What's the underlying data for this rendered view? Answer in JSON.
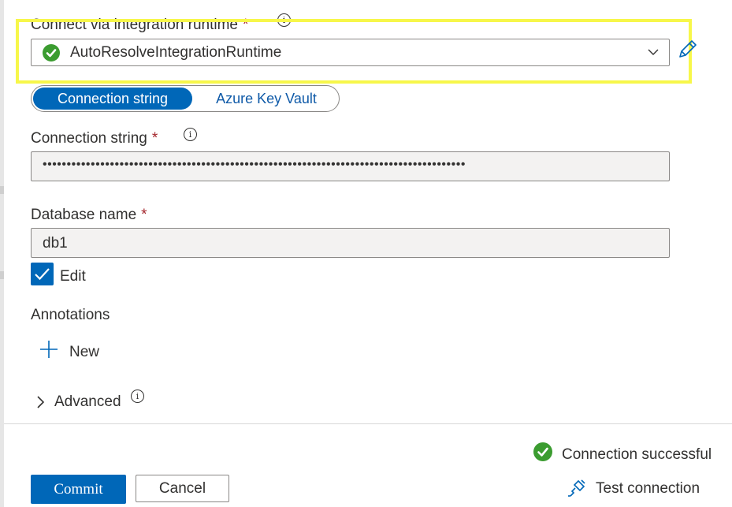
{
  "integration_runtime": {
    "label": "Connect via integration runtime",
    "required_mark": "*",
    "info": "i",
    "selected_value": "AutoResolveIntegrationRuntime"
  },
  "auth_toggle": {
    "options": [
      "Connection string",
      "Azure Key Vault"
    ],
    "selected": "Connection string"
  },
  "connection_string": {
    "label": "Connection string",
    "required_mark": "*",
    "info": "i",
    "value": "••••••••••••••••••••••••••••••••••••••••••••••••••••••••••••••••••••••••••••••••••••••••"
  },
  "database": {
    "label": "Database name",
    "required_mark": "*",
    "value": "db1"
  },
  "edit_checkbox": {
    "label": "Edit",
    "checked": true
  },
  "annotations": {
    "heading": "Annotations",
    "new_label": "New"
  },
  "advanced": {
    "label": "Advanced",
    "info": "i"
  },
  "status": {
    "text": "Connection successful"
  },
  "test_connection": {
    "label": "Test connection"
  },
  "footer": {
    "commit_label": "Commit",
    "cancel_label": "Cancel"
  },
  "colors": {
    "accent": "#0067b8",
    "success": "#3b9c30",
    "highlight": "#f7f74a",
    "required": "#a4262c"
  },
  "icons": [
    "check-circle-icon",
    "chevron-down-icon",
    "pencil-icon",
    "info-icon",
    "checkmark-icon",
    "plus-icon",
    "chevron-right-icon",
    "plug-icon"
  ]
}
